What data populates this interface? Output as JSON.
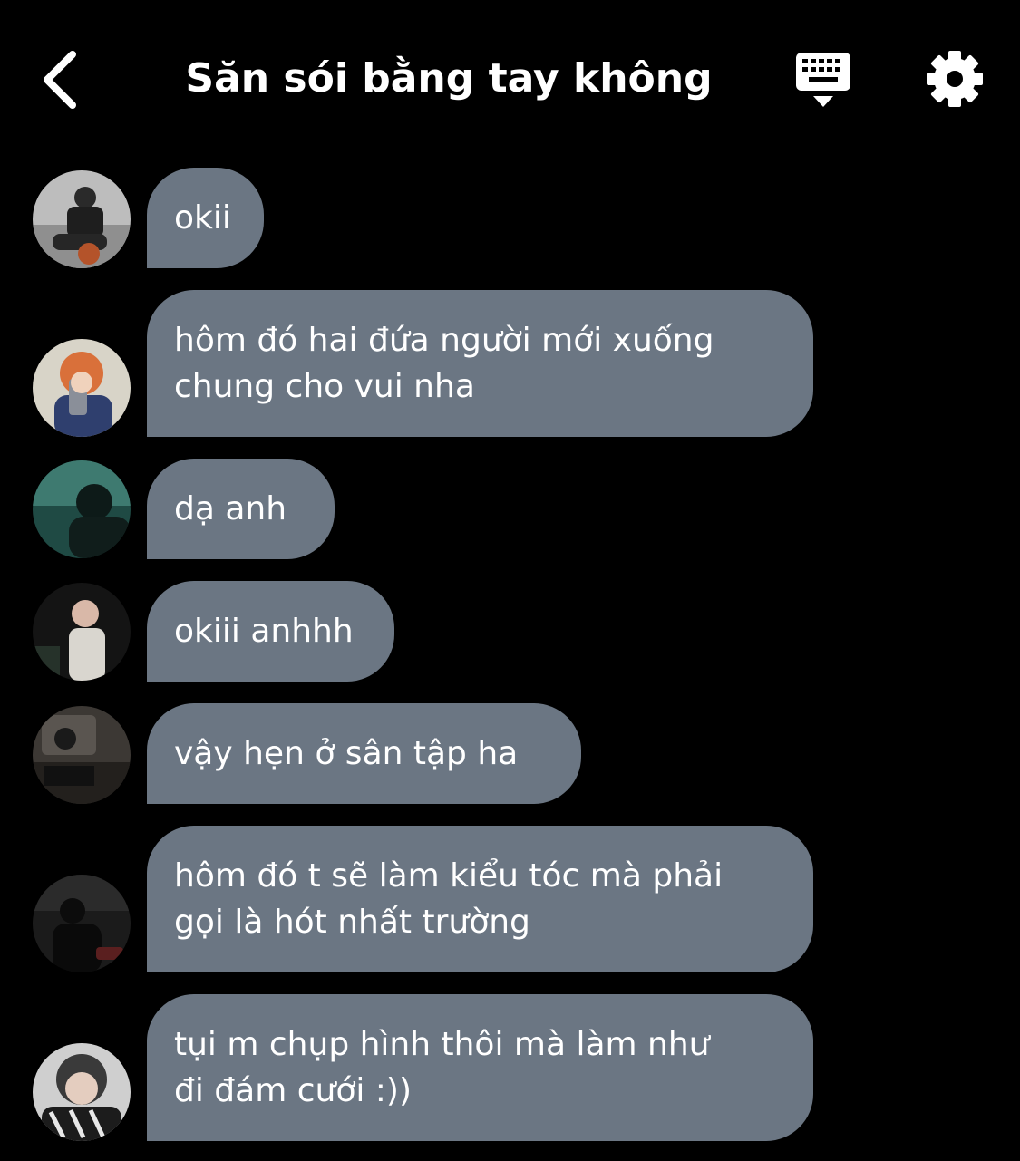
{
  "header": {
    "title": "Săn sói bằng tay không",
    "back_icon": "chevron-left-icon",
    "keyboard_icon": "keyboard-hide-icon",
    "settings_icon": "gear-icon"
  },
  "colors": {
    "background": "#000000",
    "bubble": "#6b7683",
    "text": "#ffffff"
  },
  "messages": [
    {
      "text": "okii"
    },
    {
      "text": "hôm đó hai đứa người mới xuống\nchung cho vui nha"
    },
    {
      "text": "dạ anh"
    },
    {
      "text": "okiii anhhh"
    },
    {
      "text": "vậy hẹn ở sân tập ha"
    },
    {
      "text": "hôm đó t sẽ làm kiểu tóc mà phải\ngọi là hót nhất trường"
    },
    {
      "text": "tụi m chụp hình thôi mà làm như\nđi đám cưới :))"
    }
  ]
}
